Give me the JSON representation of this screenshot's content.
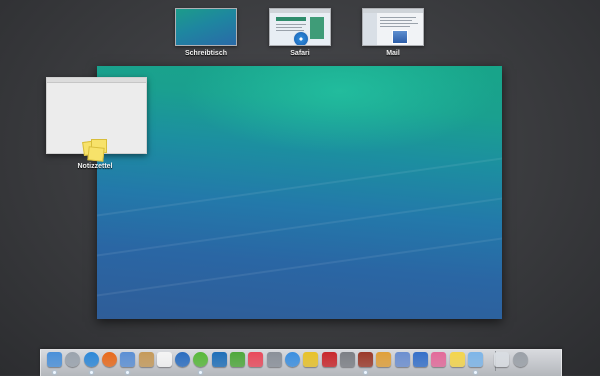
{
  "spaces": [
    {
      "name": "space-schreibtisch",
      "label": "Schreibtisch"
    },
    {
      "name": "space-safari",
      "label": "Safari"
    },
    {
      "name": "space-mail",
      "label": "Mail"
    }
  ],
  "mission_control": {
    "desktop_window_label": "",
    "notes_window_label": "Notizzettel"
  },
  "dock": {
    "apps": [
      {
        "name": "finder",
        "color": "#4a90d9"
      },
      {
        "name": "launchpad",
        "color": "#9aa3ad"
      },
      {
        "name": "safari",
        "color": "#2d88d8"
      },
      {
        "name": "firefox",
        "color": "#e86a1c"
      },
      {
        "name": "mail",
        "color": "#5b8fd4"
      },
      {
        "name": "contacts",
        "color": "#c59a5a"
      },
      {
        "name": "calendar",
        "color": "#f4f4f4"
      },
      {
        "name": "1password",
        "color": "#2a6dc0"
      },
      {
        "name": "itunes-radio",
        "color": "#58b83a"
      },
      {
        "name": "app-blue",
        "color": "#1f6fb8"
      },
      {
        "name": "evernote",
        "color": "#4fa83b"
      },
      {
        "name": "pocket",
        "color": "#e94a5b"
      },
      {
        "name": "printer",
        "color": "#8a9099"
      },
      {
        "name": "app-store",
        "color": "#3b8fe0"
      },
      {
        "name": "adium",
        "color": "#e8c22a"
      },
      {
        "name": "filezilla",
        "color": "#c9282c"
      },
      {
        "name": "app-gray",
        "color": "#7c7f85"
      },
      {
        "name": "dictionary",
        "color": "#9b3a2a"
      },
      {
        "name": "app-orange",
        "color": "#e0a03a"
      },
      {
        "name": "keynote",
        "color": "#6c8fd0"
      },
      {
        "name": "app-blue2",
        "color": "#3570c9"
      },
      {
        "name": "preview",
        "color": "#e36a9a"
      },
      {
        "name": "stickies",
        "color": "#f4d54c"
      },
      {
        "name": "folder",
        "color": "#7db5e8"
      },
      {
        "name": "documents",
        "color": "#d9dde2"
      },
      {
        "name": "trash",
        "color": "#9aa0a7"
      }
    ]
  }
}
